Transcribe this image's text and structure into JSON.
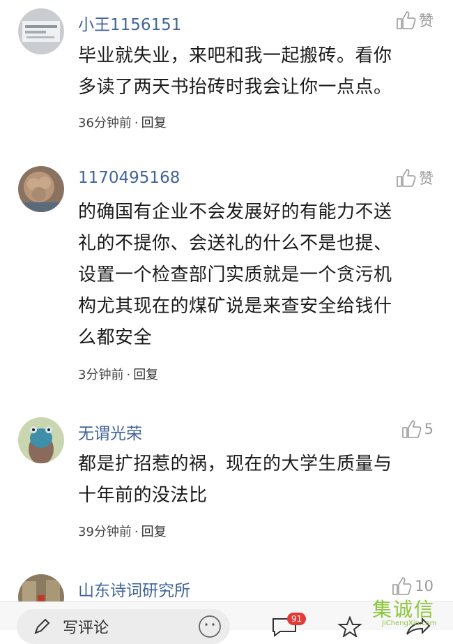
{
  "comments": [
    {
      "username": "小王1156151",
      "like_label": "赞",
      "lines": [
        "毕业就失业，来吧和我一起搬砖。看你",
        "多读了两天书抬砖时我会让你一点点。"
      ],
      "time": "36分钟前",
      "reply": "回复",
      "avatar_colors": [
        "#bfc4c9",
        "#8e96a0"
      ]
    },
    {
      "username": "1170495168",
      "like_label": "赞",
      "lines": [
        "的确国有企业不会发展好的有能力不送",
        "礼的不提你、会送礼的什么不是也提、",
        "设置一个检查部门实质就是一个贪污机",
        "构尤其现在的煤矿说是来查安全给钱什",
        "么都安全"
      ],
      "time": "3分钟前",
      "reply": "回复",
      "avatar_colors": [
        "#b08a6e",
        "#6e5a4a"
      ]
    },
    {
      "username": "无谓光荣",
      "like_label": "5",
      "lines": [
        "都是扩招惹的祸，现在的大学生质量与",
        "十年前的没法比"
      ],
      "time": "39分钟前",
      "reply": "回复",
      "avatar_colors": [
        "#c9d6b0",
        "#3f8fa8"
      ]
    },
    {
      "username": "山东诗词研究所",
      "like_label": "10",
      "lines": [],
      "time": "",
      "reply": "",
      "avatar_colors": [
        "#9a8a70",
        "#c0392b"
      ]
    }
  ],
  "bottom_bar": {
    "write_label": "写评论",
    "comment_count": "91"
  },
  "watermark": {
    "main": "集诚信",
    "sub": "JiChengXin.com"
  }
}
